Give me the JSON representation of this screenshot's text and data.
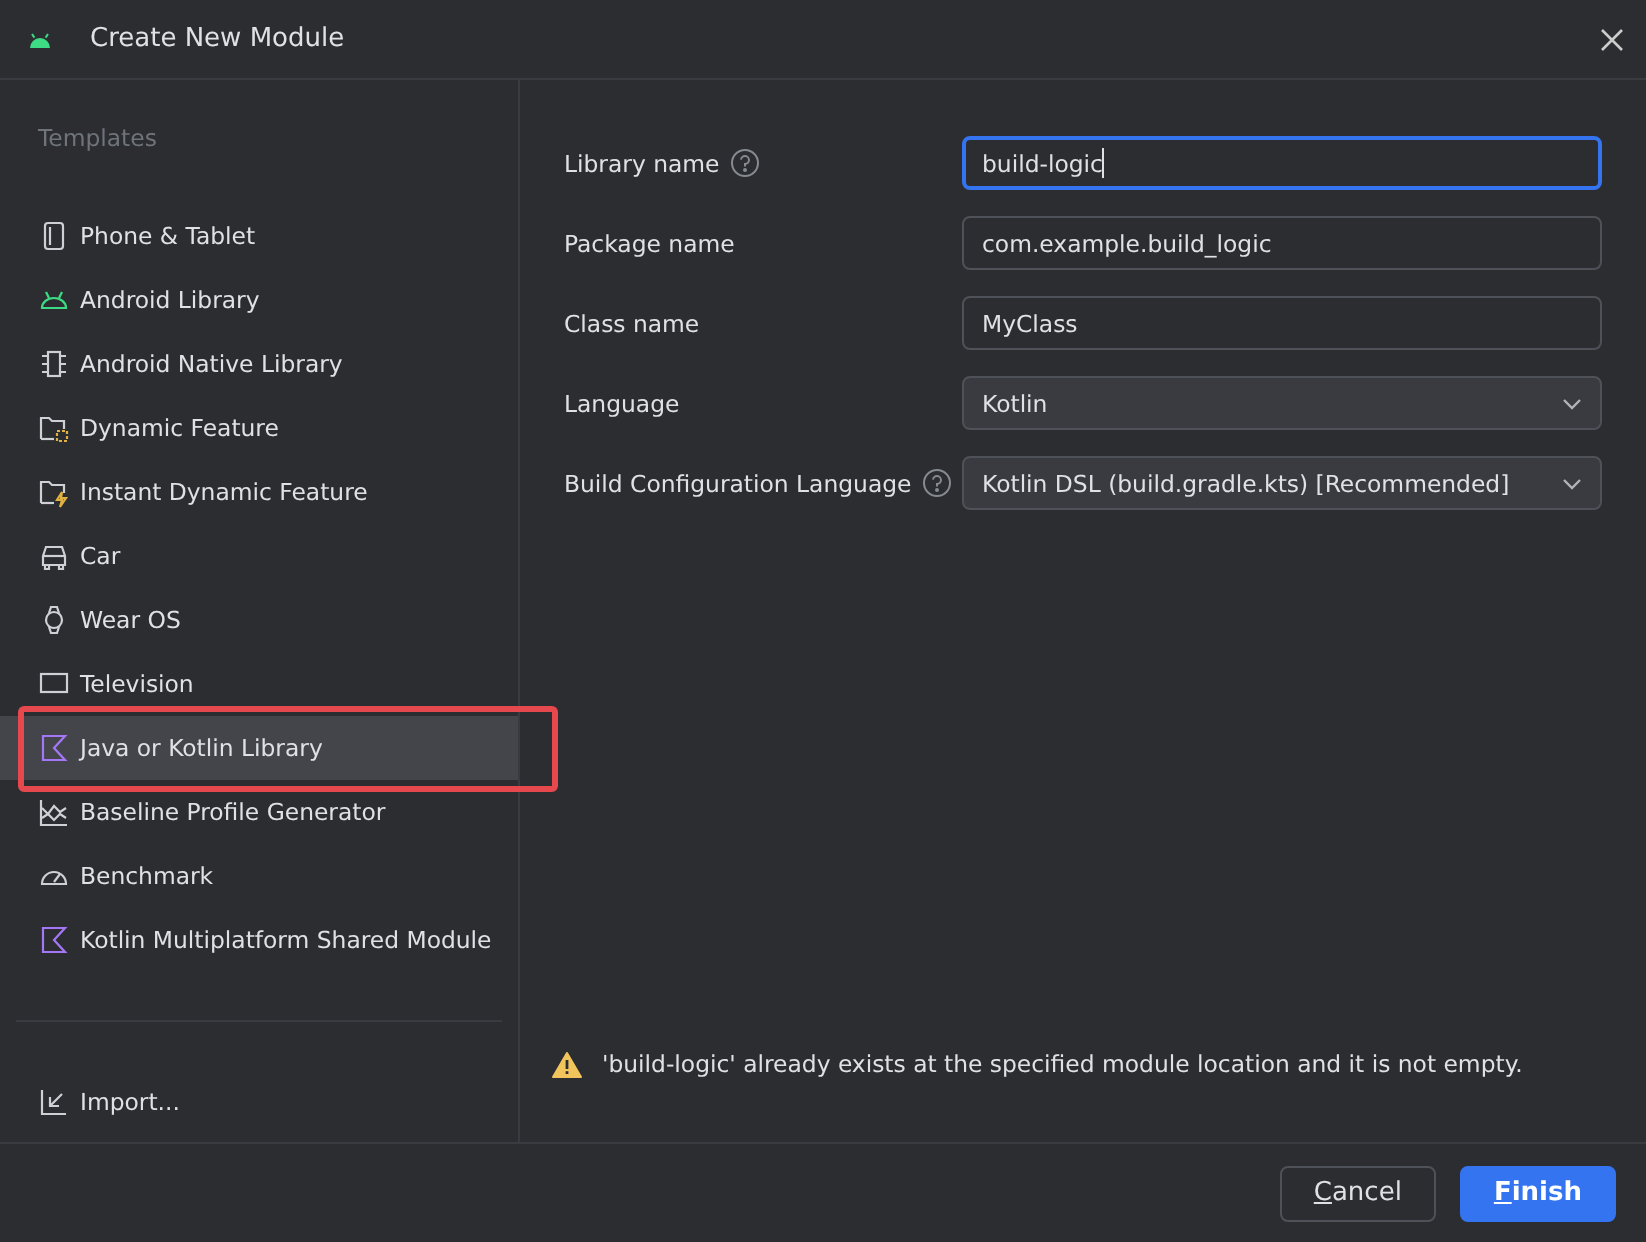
{
  "window": {
    "title": "Create New Module"
  },
  "sidebar": {
    "heading": "Templates",
    "items": [
      {
        "label": "Phone & Tablet",
        "selected": false
      },
      {
        "label": "Android Library",
        "selected": false
      },
      {
        "label": "Android Native Library",
        "selected": false
      },
      {
        "label": "Dynamic Feature",
        "selected": false
      },
      {
        "label": "Instant Dynamic Feature",
        "selected": false
      },
      {
        "label": "Car",
        "selected": false
      },
      {
        "label": "Wear OS",
        "selected": false
      },
      {
        "label": "Television",
        "selected": false
      },
      {
        "label": "Java or Kotlin Library",
        "selected": true
      },
      {
        "label": "Baseline Profile Generator",
        "selected": false
      },
      {
        "label": "Benchmark",
        "selected": false
      },
      {
        "label": "Kotlin Multiplatform Shared Module",
        "selected": false
      }
    ],
    "import": "Import..."
  },
  "form": [
    {
      "label": "Library name",
      "help": true,
      "kind": "text",
      "value": "build-logic",
      "focused": true
    },
    {
      "label": "Package name",
      "help": false,
      "kind": "text",
      "value": "com.example.build_logic",
      "focused": false
    },
    {
      "label": "Class name",
      "help": false,
      "kind": "text",
      "value": "MyClass",
      "focused": false
    },
    {
      "label": "Language",
      "help": false,
      "kind": "dropdown",
      "value": "Kotlin",
      "focused": false
    },
    {
      "label": "Build Configuration Language",
      "help": true,
      "kind": "dropdown",
      "value": "Kotlin DSL (build.gradle.kts) [Recommended]",
      "focused": false
    }
  ],
  "warning": "'build-logic' already exists at the specified module location and it is not empty.",
  "buttons": [
    {
      "label": "Cancel",
      "primary": false
    },
    {
      "label": "Finish",
      "primary": true
    }
  ]
}
